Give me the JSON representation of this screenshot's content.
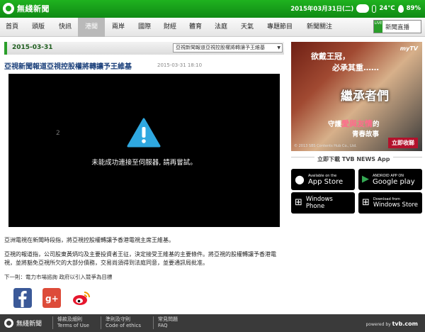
{
  "header": {
    "site_name": "無綫新聞",
    "date": "2015年03月31日(二)",
    "temperature": "24°C",
    "humidity": "89%"
  },
  "nav": {
    "items": [
      "首頁",
      "頭版",
      "快訊",
      "港聞",
      "兩岸",
      "國際",
      "財經",
      "體育",
      "法庭",
      "天氣",
      "專題節目",
      "新聞關注"
    ],
    "active": "港聞",
    "live_badge": "LIVE",
    "live_label": "新聞直播"
  },
  "article": {
    "date": "2015-03-31",
    "select_value": "亞視新聞報道亞視控股權將轉讓予王維基",
    "title": "亞視新聞報道亞視控股權將轉讓予王維基",
    "time": "2015-03-31 18:10",
    "video_number": "2",
    "video_error": "未能成功連接至伺服器, 請再嘗試。",
    "paragraphs": [
      "亞洲電視在新聞時段指，將亞視控股權轉讓予香港電視主席王維基。",
      "亞視的報道指，公司股東黃炳均及主要投資者王征，決定接受王維基的主要條件。將亞視的股權轉讓予香港電視，並將豁免亞視所欠的大部分債務，交易尚須得到法庭同意，並要通訊局批准。"
    ],
    "next_label": "下一則：",
    "next_title": "電力市場諮詢 政府以引入競爭為目標"
  },
  "social": [
    {
      "name": "facebook",
      "color": "#3b5998"
    },
    {
      "name": "google-plus",
      "color": "#dd4b39"
    },
    {
      "name": "weibo",
      "color": "#ffffff"
    }
  ],
  "ad": {
    "brand": "myTV",
    "line1": "欲戴王冠，",
    "line2": "必承其重……",
    "title": "繼承者們",
    "sub1_pre": "守護",
    "sub1_hl": "愛與友情",
    "sub1_post": "的",
    "sub2": "青春故事",
    "copyright": "© 2013 SBS Contents Hub Co., Ltd.",
    "cta": "立即收睇"
  },
  "download": {
    "heading": "立即下載 TVB NEWS App",
    "stores": [
      {
        "small": "Available on the",
        "large": "App Store"
      },
      {
        "small": "ANDROID APP ON",
        "large": "Google play"
      },
      {
        "small": "Windows",
        "large": "Phone"
      },
      {
        "small": "Download from",
        "large": "Windows Store"
      }
    ]
  },
  "footer": {
    "site_name": "無綫新聞",
    "links": [
      {
        "zh": "條款及細則",
        "en": "Terms of Use"
      },
      {
        "zh": "準則及守則",
        "en": "Code of ethics"
      },
      {
        "zh": "常見問題",
        "en": "FAQ"
      }
    ],
    "powered_by": "powered by",
    "powered_brand": "tvb.com"
  }
}
